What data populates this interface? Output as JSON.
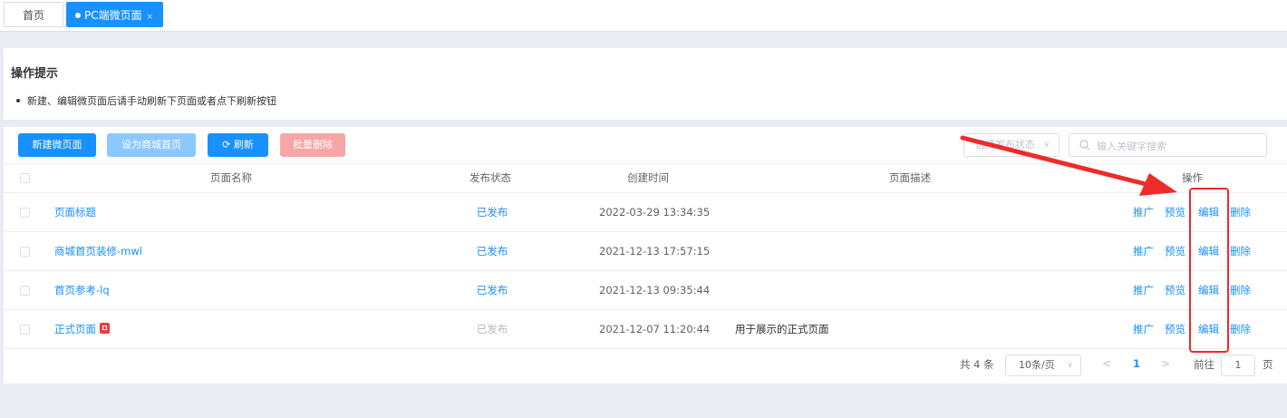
{
  "tabs": {
    "home_label": "首页",
    "active_label": "PC端微页面",
    "close_glyph": "×"
  },
  "tips": {
    "title": "操作提示",
    "items": [
      "新建、编辑微页面后请手动刷新下页面或者点下刷新按钮"
    ]
  },
  "toolbar": {
    "new_label": "新建微页面",
    "set_home_label": "设为商城首页",
    "refresh_label": "刷新",
    "batch_delete_label": "批量删除",
    "status_placeholder": "选择发布状态",
    "search_placeholder": "输入关键字搜索"
  },
  "table": {
    "headers": {
      "name": "页面名称",
      "status": "发布状态",
      "created": "创建时间",
      "desc": "页面描述",
      "ops": "操作"
    },
    "ops": {
      "promote": "推广",
      "preview": "预览",
      "edit": "编辑",
      "delete": "删除"
    },
    "rows": [
      {
        "name": "页面标题",
        "status": "已发布",
        "created": "2022-03-29 13:34:35",
        "desc": ""
      },
      {
        "name": "商城首页装修-mwl",
        "status": "已发布",
        "created": "2021-12-13 17:57:15",
        "desc": ""
      },
      {
        "name": "首页参考-lq",
        "status": "已发布",
        "created": "2021-12-13 09:35:44",
        "desc": ""
      },
      {
        "name": "正式页面",
        "status": "已发布",
        "created": "2021-12-07 11:20:44",
        "desc": "用于展示的正式页面"
      }
    ]
  },
  "pagination": {
    "total": "共 4 条",
    "page_size": "10条/页",
    "current": "1",
    "goto_label": "前往",
    "goto_value": "1",
    "page_suffix": "页"
  },
  "colors": {
    "primary": "#1890ff",
    "danger_light": "#f7a6a6",
    "annotation": "#ee2b2b"
  }
}
